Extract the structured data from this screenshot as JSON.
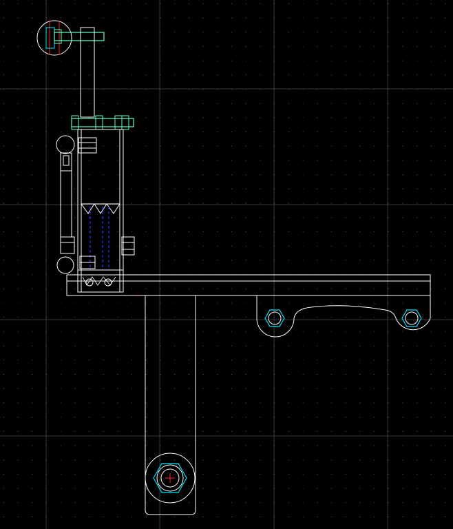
{
  "app": {
    "view": "cad-model-space",
    "background": "#000000"
  },
  "canvas": {
    "grid": {
      "visible": true,
      "dot_color": "#5a5a5a",
      "major_line_color": "#3a3a3a"
    },
    "layer_colors": {
      "geometry": "#ffffff",
      "fastener": "#66ffcc",
      "nut": "#00e5ff",
      "hidden": "#2233ff",
      "centerline": "#ff2222",
      "crosshair": "#ff3333"
    }
  },
  "drawing": {
    "parts": [
      {
        "name": "vertical-arm",
        "type": "plate"
      },
      {
        "name": "horizontal-beam",
        "type": "plate"
      },
      {
        "name": "mounting-bracket",
        "type": "bracket"
      },
      {
        "name": "pulley-housing",
        "type": "assembly"
      },
      {
        "name": "top-clamp-bolt",
        "type": "fastener"
      },
      {
        "name": "cross-bolt",
        "type": "fastener"
      },
      {
        "name": "pivot-nut",
        "type": "fastener"
      }
    ]
  }
}
